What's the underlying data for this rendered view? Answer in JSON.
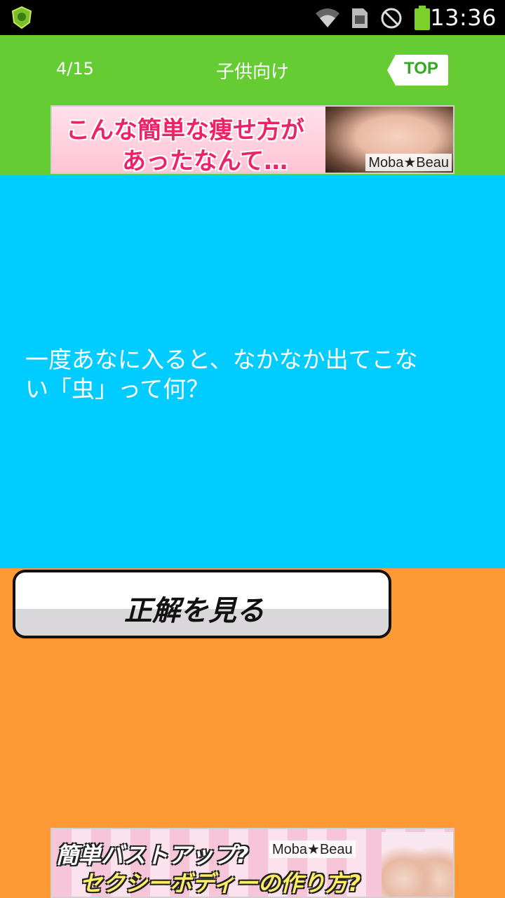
{
  "status_bar": {
    "time": "13:36",
    "icons": [
      "app-shield-icon",
      "wifi-icon",
      "sim-card-icon",
      "do-not-disturb-icon",
      "battery-icon"
    ]
  },
  "header": {
    "counter": "4/15",
    "title": "子供向け",
    "top_button_label": "TOP"
  },
  "ads": {
    "top": {
      "line1": "こんな簡単な痩せ方が",
      "line2": "あったなんて…",
      "brand": "Moba★Beau"
    },
    "bottom": {
      "line1": "簡単バストアップ?",
      "line2": "セクシーボディーの作り方?",
      "brand": "Moba★Beau"
    }
  },
  "question": {
    "text": "一度あなに入ると、なかなか出てこない「虫」って何？"
  },
  "answer_button": {
    "label": "正解を見る"
  },
  "colors": {
    "header_bg": "#66cc33",
    "question_bg": "#00ccff",
    "page_bg": "#ff9933"
  }
}
